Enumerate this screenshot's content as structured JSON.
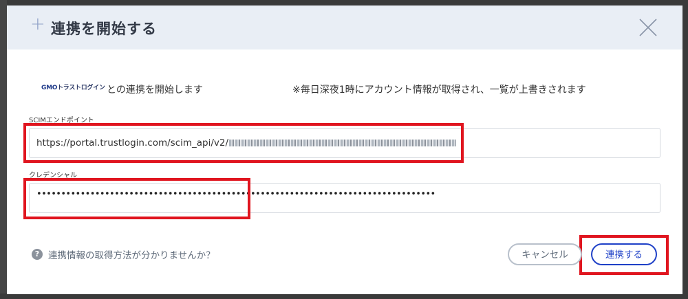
{
  "modal": {
    "title": "連携を開始する",
    "plus_symbol": "+",
    "close_icon": "close-icon"
  },
  "brand": {
    "logo_gmo": "GMO",
    "logo_rest": "トラストログイン"
  },
  "intro": {
    "text": "との連携を開始します",
    "note": "※毎日深夜1時にアカウント情報が取得され、一覧が上書きされます"
  },
  "fields": {
    "scim_label": "SCIMエンドポイント",
    "scim_value": "https://portal.trustlogin.com/scim_api/v2/",
    "credential_label": "クレデンシャル",
    "credential_value": "••••••••••••••••••••••••••••••••••••••••••••••••••••••••••••••••••••••••••••••••••"
  },
  "help": {
    "icon": "?",
    "text": "連携情報の取得方法が分かりませんか？"
  },
  "buttons": {
    "cancel": "キャンセル",
    "submit": "連携する"
  },
  "colors": {
    "highlight": "#e0151f",
    "primary": "#1e40c7",
    "header_bg": "#e9eef5"
  }
}
